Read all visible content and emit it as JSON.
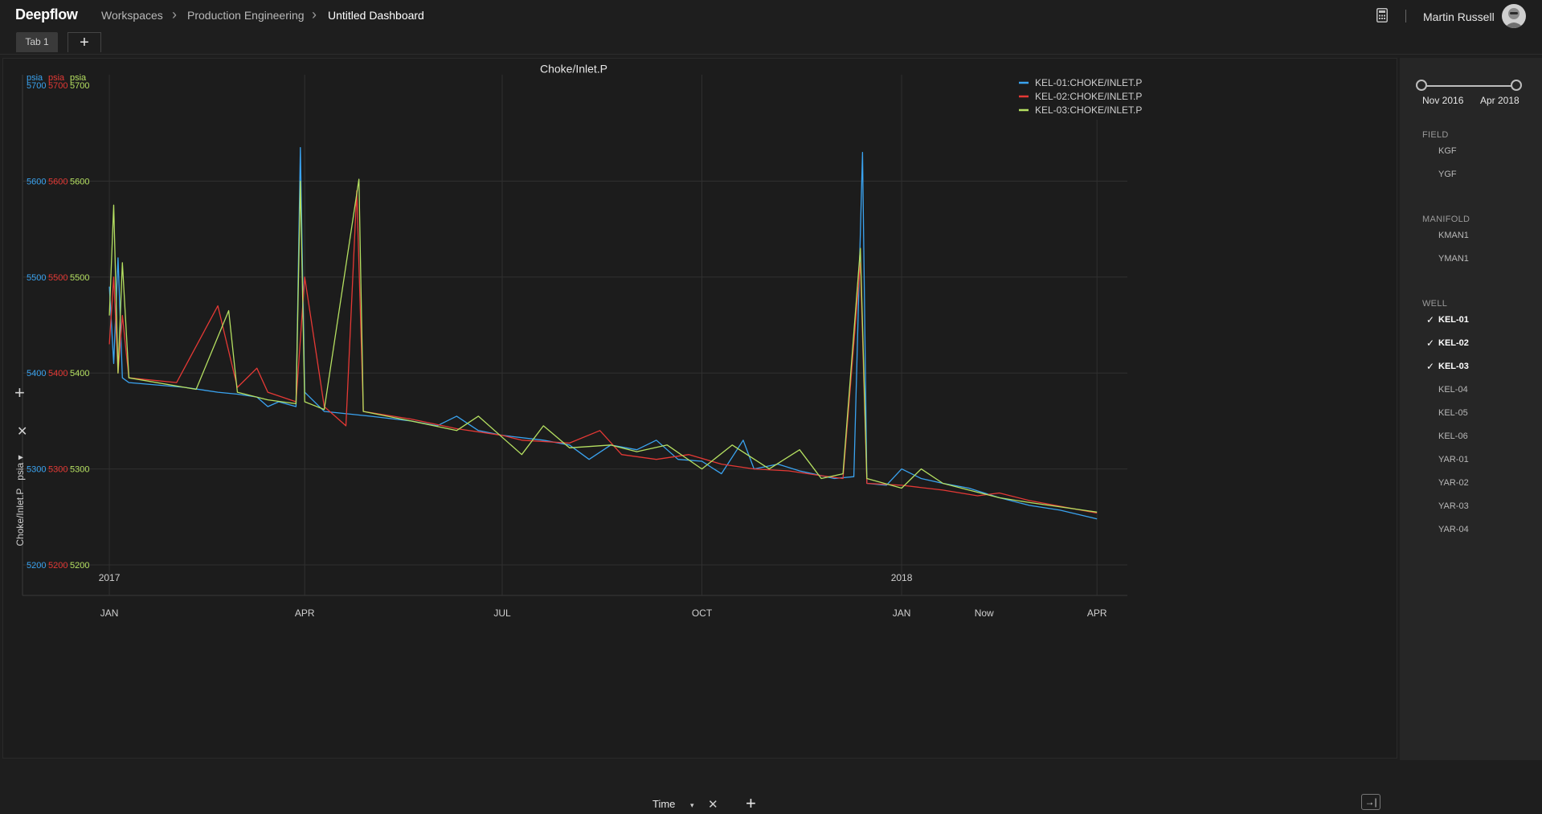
{
  "app": {
    "logo": "Deepflow",
    "breadcrumb": [
      "Workspaces",
      "Production Engineering",
      "Untitled Dashboard"
    ],
    "user": "Martin Russell",
    "icons": [
      "calculator-icon",
      "avatar",
      "chevron-right-icon",
      "plus-icon",
      "close-icon",
      "expand-icon"
    ]
  },
  "tabs": {
    "items": [
      "Tab 1"
    ],
    "add_label": "+"
  },
  "controls": {
    "x_axis_label": "Time",
    "y_axis_title": "Choke/Inlet.P",
    "y_axis_unit": "psia",
    "add_symbol": "+",
    "close_symbol": "✕",
    "caret_symbol": "▾",
    "expand_symbol": "→|"
  },
  "sidebar": {
    "range": {
      "start": "Nov 2016",
      "end": "Apr 2018"
    },
    "groups": [
      {
        "title": "FIELD",
        "items": [
          {
            "label": "KGF",
            "checked": false
          },
          {
            "label": "YGF",
            "checked": false
          }
        ]
      },
      {
        "title": "MANIFOLD",
        "items": [
          {
            "label": "KMAN1",
            "checked": false
          },
          {
            "label": "YMAN1",
            "checked": false
          }
        ]
      },
      {
        "title": "WELL",
        "items": [
          {
            "label": "KEL-01",
            "checked": true
          },
          {
            "label": "KEL-02",
            "checked": true
          },
          {
            "label": "KEL-03",
            "checked": true
          },
          {
            "label": "KEL-04",
            "checked": false
          },
          {
            "label": "KEL-05",
            "checked": false
          },
          {
            "label": "KEL-06",
            "checked": false
          },
          {
            "label": "YAR-01",
            "checked": false
          },
          {
            "label": "YAR-02",
            "checked": false
          },
          {
            "label": "YAR-03",
            "checked": false
          },
          {
            "label": "YAR-04",
            "checked": false
          }
        ]
      }
    ]
  },
  "chart_data": {
    "type": "line",
    "title": "Choke/Inlet.P",
    "ylabel": "Choke/Inlet.P",
    "y_unit": "psia",
    "ylim": [
      5200,
      5700
    ],
    "y_ticks": [
      5200,
      5300,
      5400,
      5500,
      5600,
      5700
    ],
    "xlim": [
      "2016-11-22",
      "2018-04-15"
    ],
    "x_ticks": [
      {
        "date": "2017-01-01",
        "label": "JAN",
        "year": "2017"
      },
      {
        "date": "2017-04-01",
        "label": "APR",
        "year": ""
      },
      {
        "date": "2017-07-01",
        "label": "JUL",
        "year": ""
      },
      {
        "date": "2017-10-01",
        "label": "OCT",
        "year": ""
      },
      {
        "date": "2018-01-01",
        "label": "JAN",
        "year": "2018"
      },
      {
        "date": "2018-04-01",
        "label": "APR",
        "year": ""
      },
      {
        "date": "2018-02-08",
        "label": "Now",
        "year": ""
      }
    ],
    "grid": true,
    "legend_position": "top-right",
    "series": [
      {
        "name": "KEL-01:CHOKE/INLET.P",
        "color": "#3aa3f0",
        "points": [
          [
            "2017-01-01",
            5490
          ],
          [
            "2017-01-03",
            5410
          ],
          [
            "2017-01-05",
            5520
          ],
          [
            "2017-01-07",
            5395
          ],
          [
            "2017-01-10",
            5390
          ],
          [
            "2017-02-05",
            5385
          ],
          [
            "2017-02-20",
            5380
          ],
          [
            "2017-03-01",
            5378
          ],
          [
            "2017-03-10",
            5375
          ],
          [
            "2017-03-15",
            5365
          ],
          [
            "2017-03-20",
            5370
          ],
          [
            "2017-03-28",
            5365
          ],
          [
            "2017-03-30",
            5635
          ],
          [
            "2017-04-01",
            5380
          ],
          [
            "2017-04-10",
            5360
          ],
          [
            "2017-05-01",
            5355
          ],
          [
            "2017-05-20",
            5350
          ],
          [
            "2017-06-01",
            5345
          ],
          [
            "2017-06-10",
            5355
          ],
          [
            "2017-06-20",
            5340
          ],
          [
            "2017-07-01",
            5335
          ],
          [
            "2017-07-20",
            5330
          ],
          [
            "2017-08-01",
            5325
          ],
          [
            "2017-08-10",
            5310
          ],
          [
            "2017-08-20",
            5325
          ],
          [
            "2017-09-01",
            5320
          ],
          [
            "2017-09-10",
            5330
          ],
          [
            "2017-09-20",
            5310
          ],
          [
            "2017-10-01",
            5308
          ],
          [
            "2017-10-10",
            5295
          ],
          [
            "2017-10-20",
            5330
          ],
          [
            "2017-10-25",
            5300
          ],
          [
            "2017-11-05",
            5305
          ],
          [
            "2017-11-15",
            5298
          ],
          [
            "2017-12-01",
            5290
          ],
          [
            "2017-12-10",
            5292
          ],
          [
            "2017-12-14",
            5630
          ],
          [
            "2017-12-16",
            5285
          ],
          [
            "2017-12-25",
            5283
          ],
          [
            "2018-01-01",
            5300
          ],
          [
            "2018-01-10",
            5290
          ],
          [
            "2018-01-20",
            5285
          ],
          [
            "2018-02-01",
            5280
          ],
          [
            "2018-02-15",
            5270
          ],
          [
            "2018-03-01",
            5262
          ],
          [
            "2018-03-15",
            5257
          ],
          [
            "2018-04-01",
            5248
          ]
        ]
      },
      {
        "name": "KEL-02:CHOKE/INLET.P",
        "color": "#e53935",
        "points": [
          [
            "2017-01-01",
            5430
          ],
          [
            "2017-01-03",
            5500
          ],
          [
            "2017-01-05",
            5400
          ],
          [
            "2017-01-07",
            5460
          ],
          [
            "2017-01-10",
            5395
          ],
          [
            "2017-02-01",
            5390
          ],
          [
            "2017-02-20",
            5470
          ],
          [
            "2017-03-01",
            5385
          ],
          [
            "2017-03-10",
            5405
          ],
          [
            "2017-03-15",
            5380
          ],
          [
            "2017-03-28",
            5370
          ],
          [
            "2017-04-01",
            5500
          ],
          [
            "2017-04-10",
            5365
          ],
          [
            "2017-04-20",
            5345
          ],
          [
            "2017-04-25",
            5590
          ],
          [
            "2017-04-28",
            5360
          ],
          [
            "2017-05-20",
            5352
          ],
          [
            "2017-06-10",
            5342
          ],
          [
            "2017-07-01",
            5335
          ],
          [
            "2017-07-10",
            5330
          ],
          [
            "2017-08-01",
            5327
          ],
          [
            "2017-08-15",
            5340
          ],
          [
            "2017-08-25",
            5315
          ],
          [
            "2017-09-10",
            5310
          ],
          [
            "2017-09-25",
            5315
          ],
          [
            "2017-10-10",
            5305
          ],
          [
            "2017-10-25",
            5300
          ],
          [
            "2017-11-10",
            5298
          ],
          [
            "2017-11-25",
            5293
          ],
          [
            "2017-12-05",
            5290
          ],
          [
            "2017-12-13",
            5515
          ],
          [
            "2017-12-16",
            5285
          ],
          [
            "2018-01-01",
            5283
          ],
          [
            "2018-01-20",
            5278
          ],
          [
            "2018-02-05",
            5272
          ],
          [
            "2018-02-15",
            5275
          ],
          [
            "2018-03-01",
            5267
          ],
          [
            "2018-04-01",
            5254
          ]
        ]
      },
      {
        "name": "KEL-03:CHOKE/INLET.P",
        "color": "#b5e061",
        "points": [
          [
            "2017-01-01",
            5460
          ],
          [
            "2017-01-03",
            5575
          ],
          [
            "2017-01-05",
            5400
          ],
          [
            "2017-01-07",
            5515
          ],
          [
            "2017-01-10",
            5395
          ],
          [
            "2017-02-10",
            5383
          ],
          [
            "2017-02-25",
            5465
          ],
          [
            "2017-03-01",
            5380
          ],
          [
            "2017-03-15",
            5372
          ],
          [
            "2017-03-28",
            5368
          ],
          [
            "2017-03-30",
            5600
          ],
          [
            "2017-04-01",
            5370
          ],
          [
            "2017-04-10",
            5362
          ],
          [
            "2017-04-26",
            5602
          ],
          [
            "2017-04-28",
            5360
          ],
          [
            "2017-05-20",
            5350
          ],
          [
            "2017-06-10",
            5340
          ],
          [
            "2017-06-20",
            5355
          ],
          [
            "2017-07-01",
            5333
          ],
          [
            "2017-07-10",
            5315
          ],
          [
            "2017-07-20",
            5345
          ],
          [
            "2017-08-01",
            5322
          ],
          [
            "2017-08-20",
            5325
          ],
          [
            "2017-09-01",
            5318
          ],
          [
            "2017-09-15",
            5325
          ],
          [
            "2017-10-01",
            5300
          ],
          [
            "2017-10-15",
            5325
          ],
          [
            "2017-11-01",
            5300
          ],
          [
            "2017-11-15",
            5320
          ],
          [
            "2017-11-25",
            5290
          ],
          [
            "2017-12-05",
            5295
          ],
          [
            "2017-12-13",
            5530
          ],
          [
            "2017-12-16",
            5290
          ],
          [
            "2018-01-01",
            5280
          ],
          [
            "2018-01-10",
            5300
          ],
          [
            "2018-01-20",
            5285
          ],
          [
            "2018-02-01",
            5278
          ],
          [
            "2018-02-15",
            5270
          ],
          [
            "2018-03-01",
            5265
          ],
          [
            "2018-04-01",
            5255
          ]
        ]
      }
    ]
  }
}
